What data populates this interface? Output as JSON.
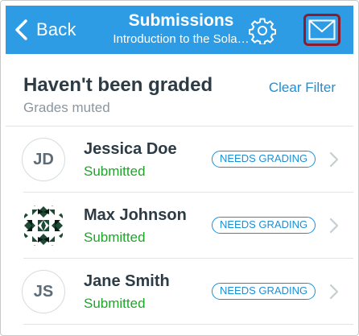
{
  "navbar": {
    "back_label": "Back",
    "title": "Submissions",
    "subtitle": "Introduction to the Sola…",
    "gear_icon": "gear-icon",
    "mail_icon": "envelope-icon",
    "color": "#2d9ce4"
  },
  "filter": {
    "title": "Haven't been graded",
    "subtitle": "Grades muted",
    "clear_label": "Clear Filter"
  },
  "submissions": [
    {
      "initials": "JD",
      "name": "Jessica Doe",
      "status": "Submitted",
      "badge": "NEEDS GRADING",
      "avatar": "initials"
    },
    {
      "initials": "",
      "name": "Max Johnson",
      "status": "Submitted",
      "badge": "NEEDS GRADING",
      "avatar": "pattern"
    },
    {
      "initials": "JS",
      "name": "Jane Smith",
      "status": "Submitted",
      "badge": "NEEDS GRADING",
      "avatar": "initials"
    }
  ],
  "colors": {
    "accent": "#1b8fd6",
    "status_green": "#1ea52a",
    "highlight_border": "#8a1c2d"
  }
}
